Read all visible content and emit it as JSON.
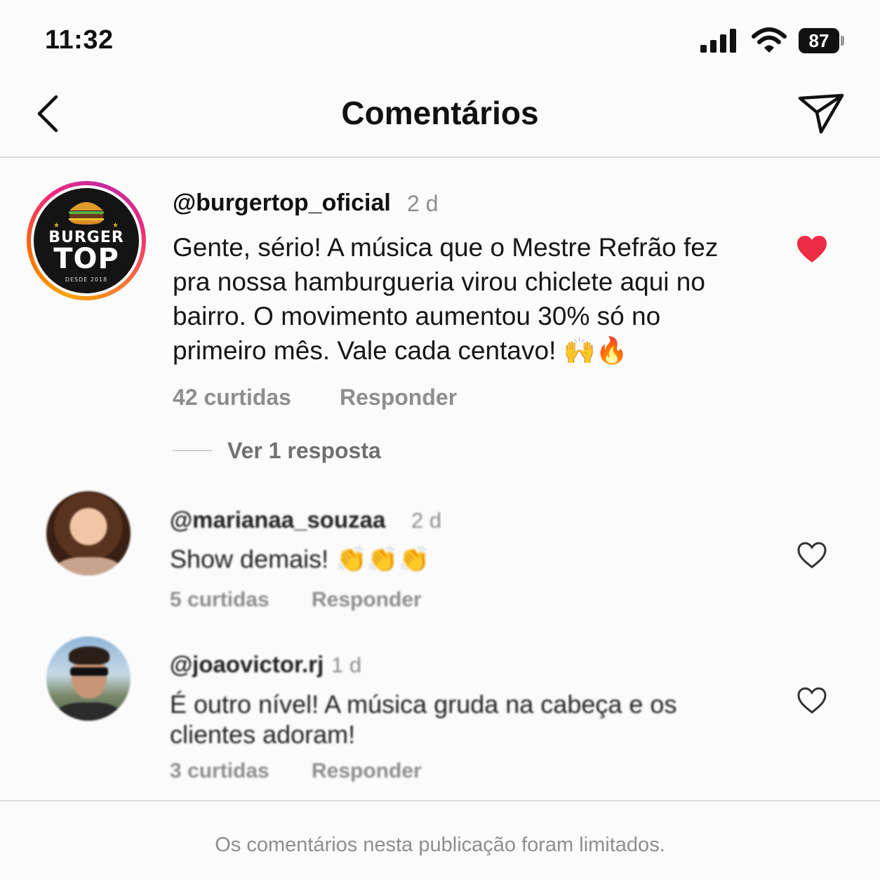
{
  "status_bar": {
    "time": "11:32",
    "battery": "87"
  },
  "header": {
    "title": "Comentários"
  },
  "main_comment": {
    "username": "@burgertop_oficial",
    "time": "2 d",
    "text": "Gente, sério! A música que o Mestre Refrão fez pra nossa hamburgueria virou chiclete aqui no bairro. O movimento aumentou 30% só no primeiro mês. Vale cada centavo! 🙌🔥",
    "likes": "42 curtidas",
    "reply_label": "Responder",
    "view_replies": "Ver 1 resposta",
    "liked": true,
    "avatar_logo": {
      "line1": "BURGER",
      "line2": "TOP",
      "line3": "DESDE 2018"
    },
    "heart_color": "#ed2c46"
  },
  "comments": [
    {
      "username": "@marianaa_souzaa",
      "time": "2 d",
      "text": "Show demais! 👏👏👏",
      "likes": "5 curtidas",
      "reply_label": "Responder",
      "liked": false
    },
    {
      "username": "@joaovictor.rj",
      "time": "1 d",
      "text": "É outro nível! A música gruda na cabeça e os clientes adoram!",
      "likes": "3 curtidas",
      "reply_label": "Responder",
      "liked": false
    }
  ],
  "footer": {
    "text": "Os comentários nesta publicação foram limitados."
  },
  "icons": {
    "back": "chevron-left-icon",
    "send": "paper-plane-icon",
    "heart_filled": "heart-filled-icon",
    "heart_outline": "heart-outline-icon"
  }
}
